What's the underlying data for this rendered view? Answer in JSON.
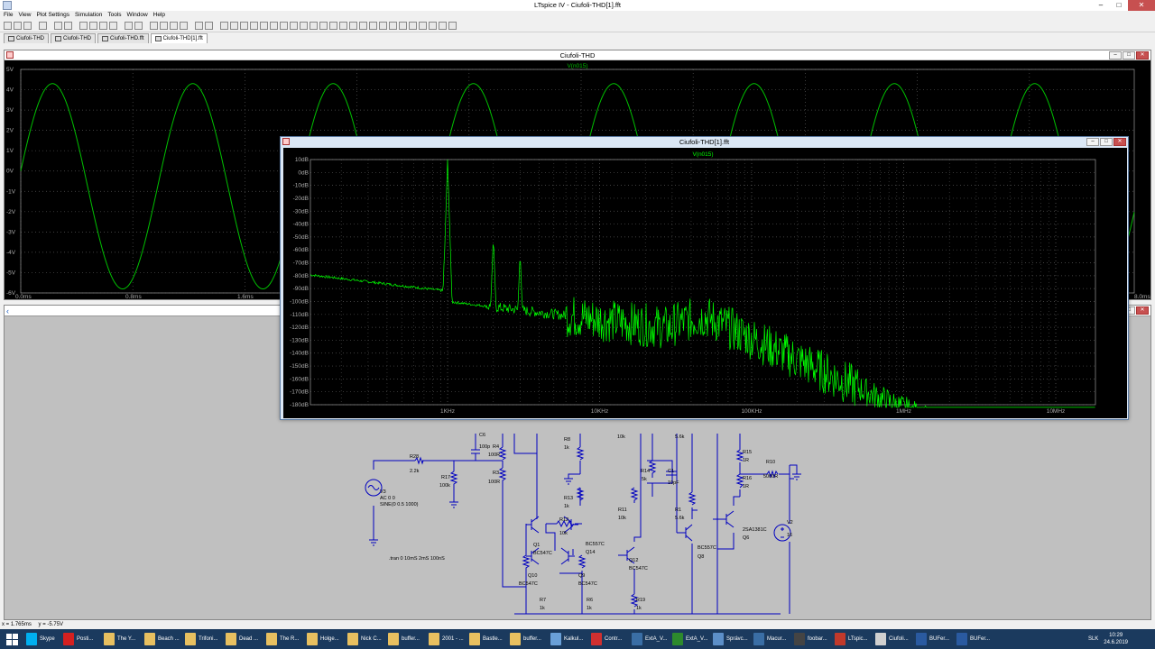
{
  "window": {
    "title": "LTspice IV - Ciufoli-THD[1].fft"
  },
  "menu": [
    "File",
    "View",
    "Plot Settings",
    "Simulation",
    "Tools",
    "Window",
    "Help"
  ],
  "tabs": [
    {
      "label": "Ciufoli-THD"
    },
    {
      "label": "Ciufoli-THD"
    },
    {
      "label": "Ciufoli-THD.fft"
    },
    {
      "label": "Ciufoli-THD[1].fft",
      "active": true
    }
  ],
  "plot1": {
    "title": "Ciufoli-THD",
    "trace": "V(n015)",
    "yticks": [
      "5V",
      "4V",
      "3V",
      "2V",
      "1V",
      "0V",
      "-1V",
      "-2V",
      "-3V",
      "-4V",
      "-5V",
      "-6V"
    ],
    "xticks": [
      "0.0ms",
      "0.8ms",
      "1.6ms"
    ],
    "xtick_right": "8.0ms",
    "trace_color": "#00c000"
  },
  "fft": {
    "title": "Ciufoli-THD[1].fft",
    "trace": "V(n015)",
    "yticks": [
      "10dB",
      "0dB",
      "-10dB",
      "-20dB",
      "-30dB",
      "-40dB",
      "-50dB",
      "-60dB",
      "-70dB",
      "-80dB",
      "-90dB",
      "-100dB",
      "-110dB",
      "-120dB",
      "-130dB",
      "-140dB",
      "-150dB",
      "-160dB",
      "-170dB",
      "-180dB"
    ],
    "xticks": [
      "1KHz",
      "10KHz",
      "100KHz",
      "1MHz",
      "10MHz"
    ],
    "trace_color": "#00ff00"
  },
  "schematic": {
    "labels": {
      "c6": "C6",
      "c6v": "100p",
      "r4": "R4",
      "r4v": "100R",
      "r3": "R3",
      "r3v": "100R",
      "r8": "R8",
      "r8v": "1k",
      "r28": "R28",
      "r28v": "2.2k",
      "r17": "R17",
      "r17v": "100k",
      "v3": "V3",
      "v3a": "AC 0 0",
      "v3b": "SINE(0 0.5 1000)",
      "r13": "R13",
      "r13v": "1k",
      "r12": "R12",
      "r12v": "10k",
      "r14": "R14",
      "r14v": "5k",
      "c1": "C1",
      "c1v": "10pF",
      "r11": "R11",
      "r11v": "10k",
      "r15": "R15",
      "r15v": "1R",
      "r16": "R16",
      "r16v": "1R",
      "r10": "R10",
      "r10v": "5000R",
      "r1": "R1",
      "r1v": "5.6k",
      "topv1": "10k",
      "topv2": "5.6k",
      "q1": "Q1",
      "q1v": "BC547C",
      "q14v": "BC557C",
      "q14": "Q14",
      "q10": "Q10",
      "q10v": "BC547C",
      "q9": "Q9",
      "q9v": "BC547C",
      "q12": "Q12",
      "q12v": "BC547C",
      "q8v": "BC557C",
      "q8": "Q8",
      "q6v": "2SA1381C",
      "q6": "Q6",
      "v2": "V2",
      "v2v": "16",
      "r7": "R7",
      "r7v": "1k",
      "r6": "R6",
      "r6v": "1k",
      "r19": "R19",
      "r19v": "1k",
      "directive": ".tran 0 10mS 2mS 100nS"
    }
  },
  "status": {
    "x": "x = 1.765ms",
    "y": "y = -5.75V"
  },
  "taskbar": {
    "items": [
      "Skype",
      "Posti...",
      "The Y...",
      "Beach ...",
      "Trifoni...",
      "Dead ...",
      "The R...",
      "Holge...",
      "Nick C...",
      "buffer...",
      "2001 - ...",
      "Bastle...",
      "buffer...",
      "Kalkul...",
      "Contr...",
      "ExtA_V...",
      "ExtA_V...",
      "Správc...",
      "Macur...",
      "foobar...",
      "LTspic...",
      "Ciufoli...",
      "BUFer...",
      "BUFer..."
    ],
    "lang": "SLK",
    "time": "10:29",
    "date": "24.6.2019"
  }
}
